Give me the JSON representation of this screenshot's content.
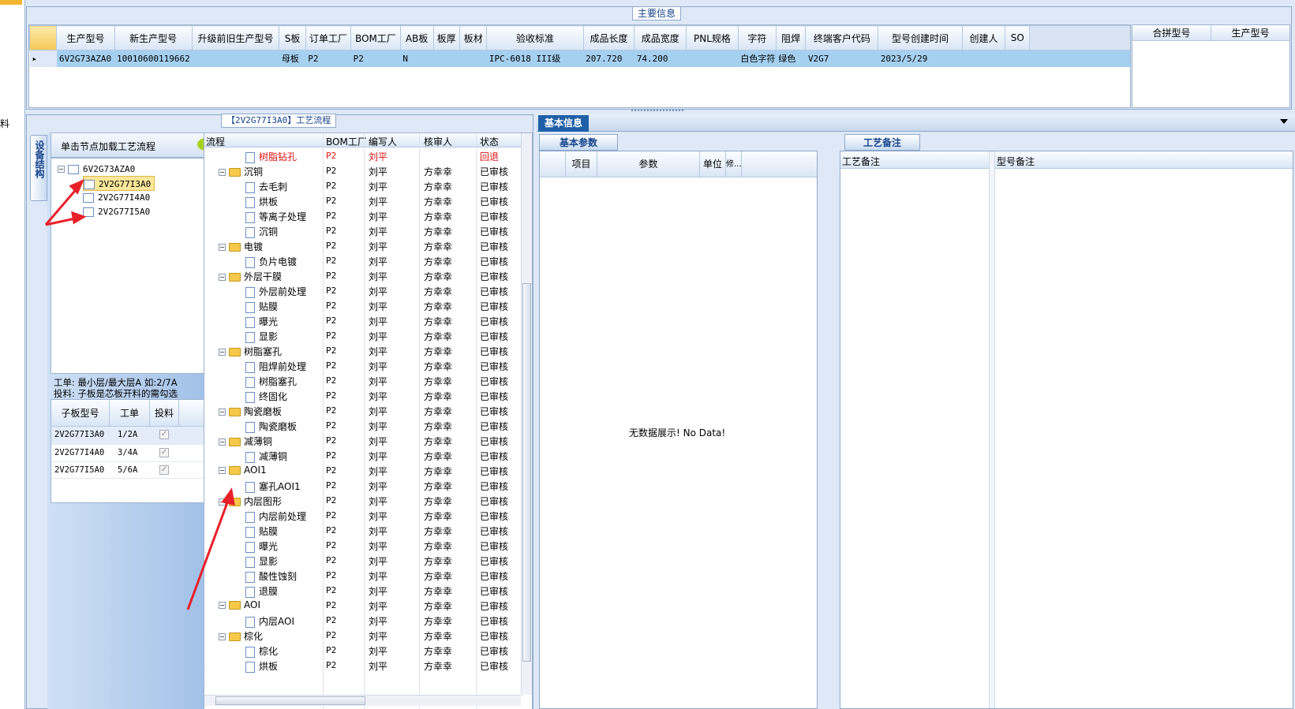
{
  "left_strip": {
    "char": "料"
  },
  "main_info": {
    "caption": "主要信息",
    "columns": [
      "生产型号",
      "新生产型号",
      "升级前旧生产型号",
      "S板",
      "订单工厂",
      "BOM工厂",
      "AB板",
      "板厚",
      "板材",
      "验收标准",
      "成品长度",
      "成品宽度",
      "PNL规格",
      "字符",
      "阻焊",
      "终端客户代码",
      "型号创建时间",
      "创建人",
      "SO"
    ],
    "row": {
      "c1": "6V2G73AZA0",
      "c2": "10010600119662",
      "c3": "",
      "c4": "母板",
      "c5": "P2",
      "c6": "P2",
      "c7": "N",
      "c8": "",
      "c9": "",
      "c10": "IPC-6018 III级",
      "c11": "207.720",
      "c12": "74.200",
      "c13": "",
      "c14": "白色字符",
      "c15": "绿色",
      "c16": "V2G7",
      "c17": "2023/5/29",
      "c18": "",
      "c19": ""
    },
    "merge_columns": [
      "合拼型号",
      "生产型号"
    ]
  },
  "process": {
    "caption": "【2V2G77I3A0】工艺流程",
    "side_tab": "设备结构",
    "load_hint": "单击节点加载工艺流程",
    "tree": {
      "root": "6V2G73AZA0",
      "children": [
        "2V2G77I3A0",
        "2V2G77I4A0",
        "2V2G77I5A0"
      ]
    },
    "note1": "工单: 最小层/最大层A 如:2/7A",
    "note2": "投料: 子板是芯板开料的需勾选",
    "sub_headers": [
      "子板型号",
      "工单",
      "投料"
    ],
    "sub_rows": [
      {
        "model": "2V2G77I3A0",
        "order": "1/2A",
        "check": "✓"
      },
      {
        "model": "2V2G77I4A0",
        "order": "3/4A",
        "check": "✓"
      },
      {
        "model": "2V2G77I5A0",
        "order": "5/6A",
        "check": "✓"
      }
    ],
    "flow_headers": [
      "流程",
      "BOM工厂",
      "编写人",
      "核审人",
      "状态"
    ],
    "flow_rows": [
      {
        "name": "树脂钻孔",
        "bom": "P2",
        "writer": "刘平",
        "reviewer": "",
        "status": "回退",
        "level": 2,
        "red": true
      },
      {
        "name": "沉铜",
        "bom": "P2",
        "writer": "刘平",
        "reviewer": "方幸幸",
        "status": "已审核",
        "level": 1
      },
      {
        "name": "去毛刺",
        "bom": "P2",
        "writer": "刘平",
        "reviewer": "方幸幸",
        "status": "已审核",
        "level": 2
      },
      {
        "name": "烘板",
        "bom": "P2",
        "writer": "刘平",
        "reviewer": "方幸幸",
        "status": "已审核",
        "level": 2
      },
      {
        "name": "等离子处理",
        "bom": "P2",
        "writer": "刘平",
        "reviewer": "方幸幸",
        "status": "已审核",
        "level": 2
      },
      {
        "name": "沉铜",
        "bom": "P2",
        "writer": "刘平",
        "reviewer": "方幸幸",
        "status": "已审核",
        "level": 2
      },
      {
        "name": "电镀",
        "bom": "P2",
        "writer": "刘平",
        "reviewer": "方幸幸",
        "status": "已审核",
        "level": 1
      },
      {
        "name": "负片电镀",
        "bom": "P2",
        "writer": "刘平",
        "reviewer": "方幸幸",
        "status": "已审核",
        "level": 2
      },
      {
        "name": "外层干膜",
        "bom": "P2",
        "writer": "刘平",
        "reviewer": "方幸幸",
        "status": "已审核",
        "level": 1
      },
      {
        "name": "外层前处理",
        "bom": "P2",
        "writer": "刘平",
        "reviewer": "方幸幸",
        "status": "已审核",
        "level": 2
      },
      {
        "name": "贴膜",
        "bom": "P2",
        "writer": "刘平",
        "reviewer": "方幸幸",
        "status": "已审核",
        "level": 2
      },
      {
        "name": "曝光",
        "bom": "P2",
        "writer": "刘平",
        "reviewer": "方幸幸",
        "status": "已审核",
        "level": 2
      },
      {
        "name": "显影",
        "bom": "P2",
        "writer": "刘平",
        "reviewer": "方幸幸",
        "status": "已审核",
        "level": 2
      },
      {
        "name": "树脂塞孔",
        "bom": "P2",
        "writer": "刘平",
        "reviewer": "方幸幸",
        "status": "已审核",
        "level": 1
      },
      {
        "name": "阻焊前处理",
        "bom": "P2",
        "writer": "刘平",
        "reviewer": "方幸幸",
        "status": "已审核",
        "level": 2
      },
      {
        "name": "树脂塞孔",
        "bom": "P2",
        "writer": "刘平",
        "reviewer": "方幸幸",
        "status": "已审核",
        "level": 2
      },
      {
        "name": "终固化",
        "bom": "P2",
        "writer": "刘平",
        "reviewer": "方幸幸",
        "status": "已审核",
        "level": 2
      },
      {
        "name": "陶瓷磨板",
        "bom": "P2",
        "writer": "刘平",
        "reviewer": "方幸幸",
        "status": "已审核",
        "level": 1
      },
      {
        "name": "陶瓷磨板",
        "bom": "P2",
        "writer": "刘平",
        "reviewer": "方幸幸",
        "status": "已审核",
        "level": 2
      },
      {
        "name": "减薄铜",
        "bom": "P2",
        "writer": "刘平",
        "reviewer": "方幸幸",
        "status": "已审核",
        "level": 1
      },
      {
        "name": "减薄铜",
        "bom": "P2",
        "writer": "刘平",
        "reviewer": "方幸幸",
        "status": "已审核",
        "level": 2
      },
      {
        "name": "AOI1",
        "bom": "P2",
        "writer": "刘平",
        "reviewer": "方幸幸",
        "status": "已审核",
        "level": 1
      },
      {
        "name": "塞孔AOI1",
        "bom": "P2",
        "writer": "刘平",
        "reviewer": "方幸幸",
        "status": "已审核",
        "level": 2
      },
      {
        "name": "内层图形",
        "bom": "P2",
        "writer": "刘平",
        "reviewer": "方幸幸",
        "status": "已审核",
        "level": 1
      },
      {
        "name": "内层前处理",
        "bom": "P2",
        "writer": "刘平",
        "reviewer": "方幸幸",
        "status": "已审核",
        "level": 2
      },
      {
        "name": "贴膜",
        "bom": "P2",
        "writer": "刘平",
        "reviewer": "方幸幸",
        "status": "已审核",
        "level": 2
      },
      {
        "name": "曝光",
        "bom": "P2",
        "writer": "刘平",
        "reviewer": "方幸幸",
        "status": "已审核",
        "level": 2
      },
      {
        "name": "显影",
        "bom": "P2",
        "writer": "刘平",
        "reviewer": "方幸幸",
        "status": "已审核",
        "level": 2
      },
      {
        "name": "酸性蚀刻",
        "bom": "P2",
        "writer": "刘平",
        "reviewer": "方幸幸",
        "status": "已审核",
        "level": 2
      },
      {
        "name": "退膜",
        "bom": "P2",
        "writer": "刘平",
        "reviewer": "方幸幸",
        "status": "已审核",
        "level": 2
      },
      {
        "name": "AOI",
        "bom": "P2",
        "writer": "刘平",
        "reviewer": "方幸幸",
        "status": "已审核",
        "level": 1
      },
      {
        "name": "内层AOI",
        "bom": "P2",
        "writer": "刘平",
        "reviewer": "方幸幸",
        "status": "已审核",
        "level": 2
      },
      {
        "name": "棕化",
        "bom": "P2",
        "writer": "刘平",
        "reviewer": "方幸幸",
        "status": "已审核",
        "level": 1
      },
      {
        "name": "棕化",
        "bom": "P2",
        "writer": "刘平",
        "reviewer": "方幸幸",
        "status": "已审核",
        "level": 2
      },
      {
        "name": "烘板",
        "bom": "P2",
        "writer": "刘平",
        "reviewer": "方幸幸",
        "status": "已审核",
        "level": 2
      }
    ]
  },
  "basic_info": {
    "tab": "基本信息",
    "param_tab": "基本参数",
    "param_headers": [
      "项目",
      "参数",
      "单位",
      "修..."
    ],
    "no_data": "无数据展示! No Data!",
    "remark_tab": "工艺备注",
    "remark_headers": [
      "工艺备注",
      "型号备注"
    ]
  },
  "colors": {
    "accent": "#1f5fa8",
    "selection": "#a6d0f0",
    "annotation": "#e8202a"
  }
}
